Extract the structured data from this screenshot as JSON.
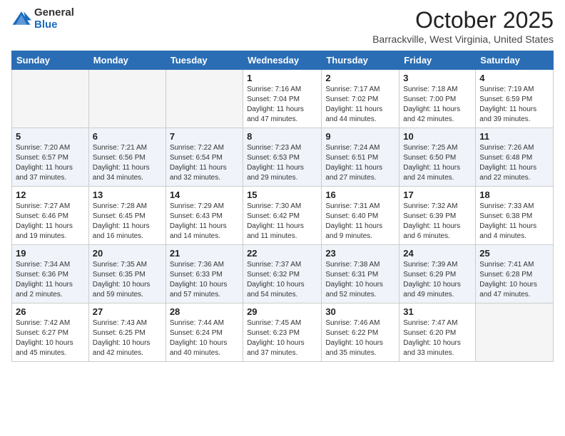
{
  "logo": {
    "line1": "General",
    "line2": "Blue"
  },
  "title": "October 2025",
  "location": "Barrackville, West Virginia, United States",
  "days_of_week": [
    "Sunday",
    "Monday",
    "Tuesday",
    "Wednesday",
    "Thursday",
    "Friday",
    "Saturday"
  ],
  "weeks": [
    [
      {
        "num": "",
        "info": ""
      },
      {
        "num": "",
        "info": ""
      },
      {
        "num": "",
        "info": ""
      },
      {
        "num": "1",
        "info": "Sunrise: 7:16 AM\nSunset: 7:04 PM\nDaylight: 11 hours and 47 minutes."
      },
      {
        "num": "2",
        "info": "Sunrise: 7:17 AM\nSunset: 7:02 PM\nDaylight: 11 hours and 44 minutes."
      },
      {
        "num": "3",
        "info": "Sunrise: 7:18 AM\nSunset: 7:00 PM\nDaylight: 11 hours and 42 minutes."
      },
      {
        "num": "4",
        "info": "Sunrise: 7:19 AM\nSunset: 6:59 PM\nDaylight: 11 hours and 39 minutes."
      }
    ],
    [
      {
        "num": "5",
        "info": "Sunrise: 7:20 AM\nSunset: 6:57 PM\nDaylight: 11 hours and 37 minutes."
      },
      {
        "num": "6",
        "info": "Sunrise: 7:21 AM\nSunset: 6:56 PM\nDaylight: 11 hours and 34 minutes."
      },
      {
        "num": "7",
        "info": "Sunrise: 7:22 AM\nSunset: 6:54 PM\nDaylight: 11 hours and 32 minutes."
      },
      {
        "num": "8",
        "info": "Sunrise: 7:23 AM\nSunset: 6:53 PM\nDaylight: 11 hours and 29 minutes."
      },
      {
        "num": "9",
        "info": "Sunrise: 7:24 AM\nSunset: 6:51 PM\nDaylight: 11 hours and 27 minutes."
      },
      {
        "num": "10",
        "info": "Sunrise: 7:25 AM\nSunset: 6:50 PM\nDaylight: 11 hours and 24 minutes."
      },
      {
        "num": "11",
        "info": "Sunrise: 7:26 AM\nSunset: 6:48 PM\nDaylight: 11 hours and 22 minutes."
      }
    ],
    [
      {
        "num": "12",
        "info": "Sunrise: 7:27 AM\nSunset: 6:46 PM\nDaylight: 11 hours and 19 minutes."
      },
      {
        "num": "13",
        "info": "Sunrise: 7:28 AM\nSunset: 6:45 PM\nDaylight: 11 hours and 16 minutes."
      },
      {
        "num": "14",
        "info": "Sunrise: 7:29 AM\nSunset: 6:43 PM\nDaylight: 11 hours and 14 minutes."
      },
      {
        "num": "15",
        "info": "Sunrise: 7:30 AM\nSunset: 6:42 PM\nDaylight: 11 hours and 11 minutes."
      },
      {
        "num": "16",
        "info": "Sunrise: 7:31 AM\nSunset: 6:40 PM\nDaylight: 11 hours and 9 minutes."
      },
      {
        "num": "17",
        "info": "Sunrise: 7:32 AM\nSunset: 6:39 PM\nDaylight: 11 hours and 6 minutes."
      },
      {
        "num": "18",
        "info": "Sunrise: 7:33 AM\nSunset: 6:38 PM\nDaylight: 11 hours and 4 minutes."
      }
    ],
    [
      {
        "num": "19",
        "info": "Sunrise: 7:34 AM\nSunset: 6:36 PM\nDaylight: 11 hours and 2 minutes."
      },
      {
        "num": "20",
        "info": "Sunrise: 7:35 AM\nSunset: 6:35 PM\nDaylight: 10 hours and 59 minutes."
      },
      {
        "num": "21",
        "info": "Sunrise: 7:36 AM\nSunset: 6:33 PM\nDaylight: 10 hours and 57 minutes."
      },
      {
        "num": "22",
        "info": "Sunrise: 7:37 AM\nSunset: 6:32 PM\nDaylight: 10 hours and 54 minutes."
      },
      {
        "num": "23",
        "info": "Sunrise: 7:38 AM\nSunset: 6:31 PM\nDaylight: 10 hours and 52 minutes."
      },
      {
        "num": "24",
        "info": "Sunrise: 7:39 AM\nSunset: 6:29 PM\nDaylight: 10 hours and 49 minutes."
      },
      {
        "num": "25",
        "info": "Sunrise: 7:41 AM\nSunset: 6:28 PM\nDaylight: 10 hours and 47 minutes."
      }
    ],
    [
      {
        "num": "26",
        "info": "Sunrise: 7:42 AM\nSunset: 6:27 PM\nDaylight: 10 hours and 45 minutes."
      },
      {
        "num": "27",
        "info": "Sunrise: 7:43 AM\nSunset: 6:25 PM\nDaylight: 10 hours and 42 minutes."
      },
      {
        "num": "28",
        "info": "Sunrise: 7:44 AM\nSunset: 6:24 PM\nDaylight: 10 hours and 40 minutes."
      },
      {
        "num": "29",
        "info": "Sunrise: 7:45 AM\nSunset: 6:23 PM\nDaylight: 10 hours and 37 minutes."
      },
      {
        "num": "30",
        "info": "Sunrise: 7:46 AM\nSunset: 6:22 PM\nDaylight: 10 hours and 35 minutes."
      },
      {
        "num": "31",
        "info": "Sunrise: 7:47 AM\nSunset: 6:20 PM\nDaylight: 10 hours and 33 minutes."
      },
      {
        "num": "",
        "info": ""
      }
    ]
  ]
}
